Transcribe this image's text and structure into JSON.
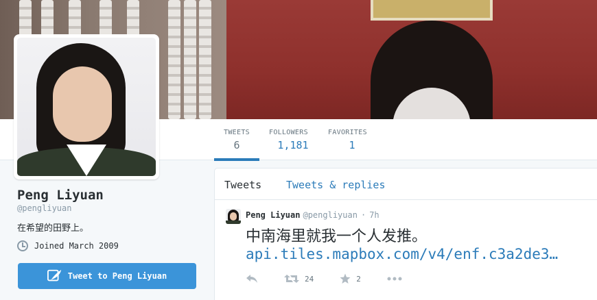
{
  "nav": {
    "stats": [
      {
        "label": "TWEETS",
        "value": "6"
      },
      {
        "label": "FOLLOWERS",
        "value": "1,181"
      },
      {
        "label": "FAVORITES",
        "value": "1"
      }
    ]
  },
  "profile": {
    "name": "Peng Liyuan",
    "handle": "@pengliyuan",
    "bio": "在希望的田野上。",
    "joined": "Joined March 2009",
    "tweet_to_label": "Tweet to Peng Liyuan"
  },
  "timeline": {
    "tabs": [
      {
        "label": "Tweets"
      },
      {
        "label": "Tweets & replies"
      }
    ],
    "tweet": {
      "name": "Peng Liyuan",
      "handle": "@pengliyuan",
      "separator": "·",
      "time": "7h",
      "text": "中南海里就我一个人发推。",
      "link": "api.tiles.mapbox.com/v4/enf.c3a2de3…",
      "retweets": "24",
      "favorites": "2"
    }
  },
  "colors": {
    "accent": "#2b7bb9",
    "button": "#3b94d9",
    "muted": "#8899a6"
  },
  "icons": [
    "clock-icon",
    "quill-icon",
    "reply-icon",
    "retweet-icon",
    "star-icon",
    "more-icon"
  ]
}
